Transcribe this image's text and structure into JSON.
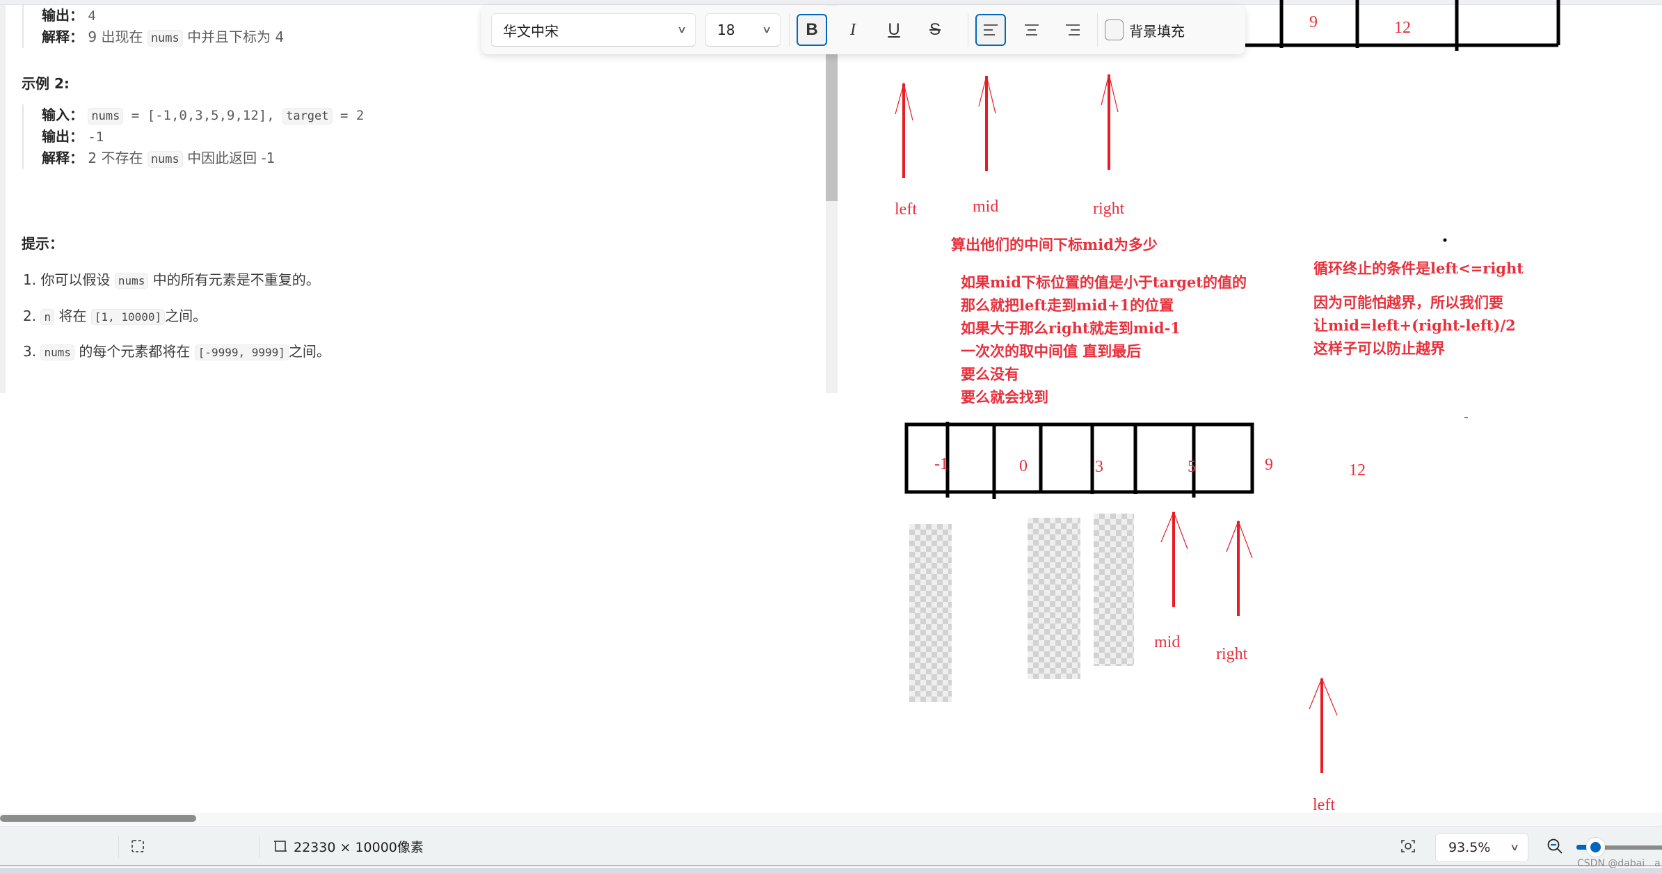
{
  "problem": {
    "example1_tail": {
      "output_label": "输出：",
      "output_value": "4",
      "explain_label": "解释：",
      "explain_parts": [
        "9 出现在 ",
        "nums",
        " 中并且下标为 4"
      ]
    },
    "example2": {
      "heading": "示例 2:",
      "input_label": "输入：",
      "input_parts": [
        "nums",
        " = [-1,0,3,5,9,12], ",
        "target",
        " = 2"
      ],
      "output_label": "输出：",
      "output_value": "-1",
      "explain_label": "解释：",
      "explain_parts": [
        "2 不存在 ",
        "nums",
        " 中因此返回 -1"
      ]
    },
    "hints": {
      "heading": "提示：",
      "items": [
        {
          "num": "1.",
          "parts": [
            "你可以假设 ",
            "nums",
            " 中的所有元素是不重复的。"
          ]
        },
        {
          "num": "2.",
          "parts": [
            "",
            "n",
            " 将在 ",
            "[1, 10000]",
            "之间。"
          ]
        },
        {
          "num": "3.",
          "parts": [
            "",
            "nums",
            " 的每个元素都将在 ",
            "[-9999, 9999]",
            "之间。"
          ]
        }
      ]
    }
  },
  "toolbar": {
    "font_family": "华文中宋",
    "font_size": "18",
    "bold_label": "B",
    "italic_label": "I",
    "underline_label": "U",
    "strike_label": "S",
    "bold_active": true,
    "align_left_active": true,
    "background_fill_label": "背景填充",
    "background_fill_checked": false
  },
  "drawing": {
    "top_array_visible_values": [
      "9",
      "12",
      ""
    ],
    "top_pointers": [
      {
        "label": "left"
      },
      {
        "label": "mid"
      },
      {
        "label": "right"
      }
    ],
    "annotation_mid": "算出他们的中间下标mid为多少",
    "annotation_steps": [
      "如果mid下标位置的值是小于target的值的",
      "那么就把left走到mid+1的位置",
      "如果大于那么right就走到mid-1",
      "一次次的取中间值 直到最后",
      "要么没有",
      "要么就会找到"
    ],
    "annotation_loop": "循环终止的条件是left<=right",
    "annotation_overflow": [
      "因为可能怕越界，所以我们要",
      "让mid=left+(right-left)/2",
      "这样子可以防止越界"
    ],
    "bottom_array_values": [
      "-1",
      "0",
      "3",
      "5",
      "9",
      "12",
      ""
    ],
    "bottom_pointers": [
      {
        "label": "mid"
      },
      {
        "label": "right"
      },
      {
        "label": "left"
      }
    ]
  },
  "statusbar": {
    "image_size": "22330 × 10000像素",
    "zoom_value": "93.5%",
    "watermark": "CSDN @dabai__a"
  },
  "colors": {
    "accent": "#0067c0",
    "annotation_red": "#e8303c"
  }
}
